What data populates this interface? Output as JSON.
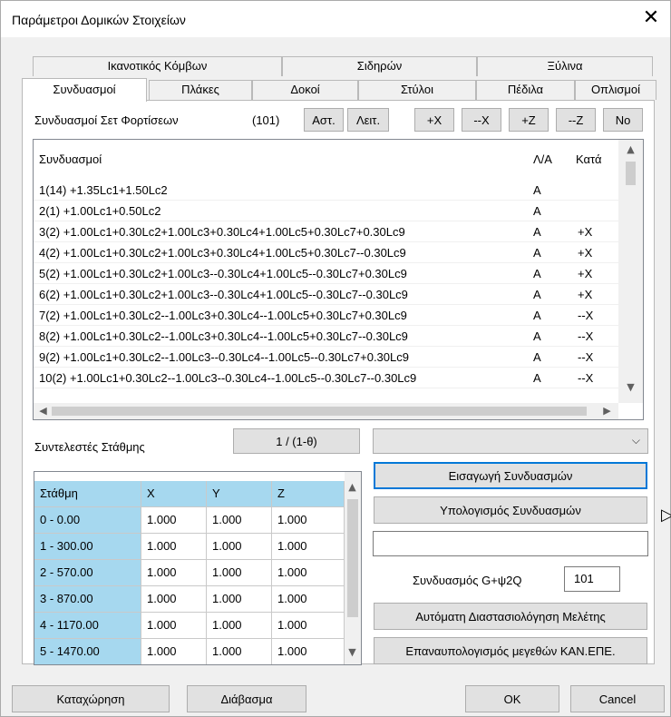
{
  "window": {
    "title": "Παράμετροι Δομικών Στοιχείων",
    "close_label": "✕"
  },
  "tabs_row1": [
    "Ικανοτικός Κόμβων",
    "Σιδηρών",
    "Ξύλινα"
  ],
  "tabs_row2": [
    "Συνδυασμοί",
    "Πλάκες",
    "Δοκοί",
    "Στύλοι",
    "Πέδιλα",
    "Οπλισμοί"
  ],
  "load_sets": {
    "label": "Συνδυασμοί Σετ Φορτίσεων",
    "count": "(101)",
    "buttons": [
      "Αστ.",
      "Λειτ.",
      "+X",
      "--X",
      "+Z",
      "--Z",
      "No"
    ]
  },
  "combos_list": {
    "headers": [
      "Συνδυασμοί",
      "Λ/Α",
      "Κατά"
    ],
    "rows": [
      [
        "1(14) +1.35Lc1+1.50Lc2",
        "A",
        ""
      ],
      [
        "2(1) +1.00Lc1+0.50Lc2",
        "A",
        ""
      ],
      [
        "3(2) +1.00Lc1+0.30Lc2+1.00Lc3+0.30Lc4+1.00Lc5+0.30Lc7+0.30Lc9",
        "A",
        "+X"
      ],
      [
        "4(2) +1.00Lc1+0.30Lc2+1.00Lc3+0.30Lc4+1.00Lc5+0.30Lc7--0.30Lc9",
        "A",
        "+X"
      ],
      [
        "5(2) +1.00Lc1+0.30Lc2+1.00Lc3--0.30Lc4+1.00Lc5--0.30Lc7+0.30Lc9",
        "A",
        "+X"
      ],
      [
        "6(2) +1.00Lc1+0.30Lc2+1.00Lc3--0.30Lc4+1.00Lc5--0.30Lc7--0.30Lc9",
        "A",
        "+X"
      ],
      [
        "7(2) +1.00Lc1+0.30Lc2--1.00Lc3+0.30Lc4--1.00Lc5+0.30Lc7+0.30Lc9",
        "A",
        "--X"
      ],
      [
        "8(2) +1.00Lc1+0.30Lc2--1.00Lc3+0.30Lc4--1.00Lc5+0.30Lc7--0.30Lc9",
        "A",
        "--X"
      ],
      [
        "9(2) +1.00Lc1+0.30Lc2--1.00Lc3--0.30Lc4--1.00Lc5--0.30Lc7+0.30Lc9",
        "A",
        "--X"
      ],
      [
        "10(2) +1.00Lc1+0.30Lc2--1.00Lc3--0.30Lc4--1.00Lc5--0.30Lc7--0.30Lc9",
        "A",
        "--X"
      ]
    ]
  },
  "level_coeffs": {
    "label": "Συντελεστές Στάθμης",
    "button": "1 / (1-θ)"
  },
  "levels_grid": {
    "headers": [
      "Στάθμη",
      "X",
      "Y",
      "Z"
    ],
    "rows": [
      [
        "0 - 0.00",
        "1.000",
        "1.000",
        "1.000"
      ],
      [
        "1 - 300.00",
        "1.000",
        "1.000",
        "1.000"
      ],
      [
        "2 - 570.00",
        "1.000",
        "1.000",
        "1.000"
      ],
      [
        "3 - 870.00",
        "1.000",
        "1.000",
        "1.000"
      ],
      [
        "4 - 1170.00",
        "1.000",
        "1.000",
        "1.000"
      ],
      [
        "5 - 1470.00",
        "1.000",
        "1.000",
        "1.000"
      ]
    ]
  },
  "actions": {
    "insert": "Εισαγωγή Συνδυασμών",
    "compute": "Υπολογισμός Συνδυασμών",
    "g_label": "Συνδυασμός G+ψ2Q",
    "g_value": "101",
    "auto_design": "Αυτόματη Διαστασιολόγηση Μελέτης",
    "recompute": "Επαναυπολογισμός μεγεθών ΚΑΝ.ΕΠΕ."
  },
  "footer": {
    "save": "Καταχώρηση",
    "read": "Διάβασμα",
    "ok": "OK",
    "cancel": "Cancel"
  },
  "colors": {
    "grid_header": "#a6d8ef",
    "focus": "#0078d7"
  }
}
